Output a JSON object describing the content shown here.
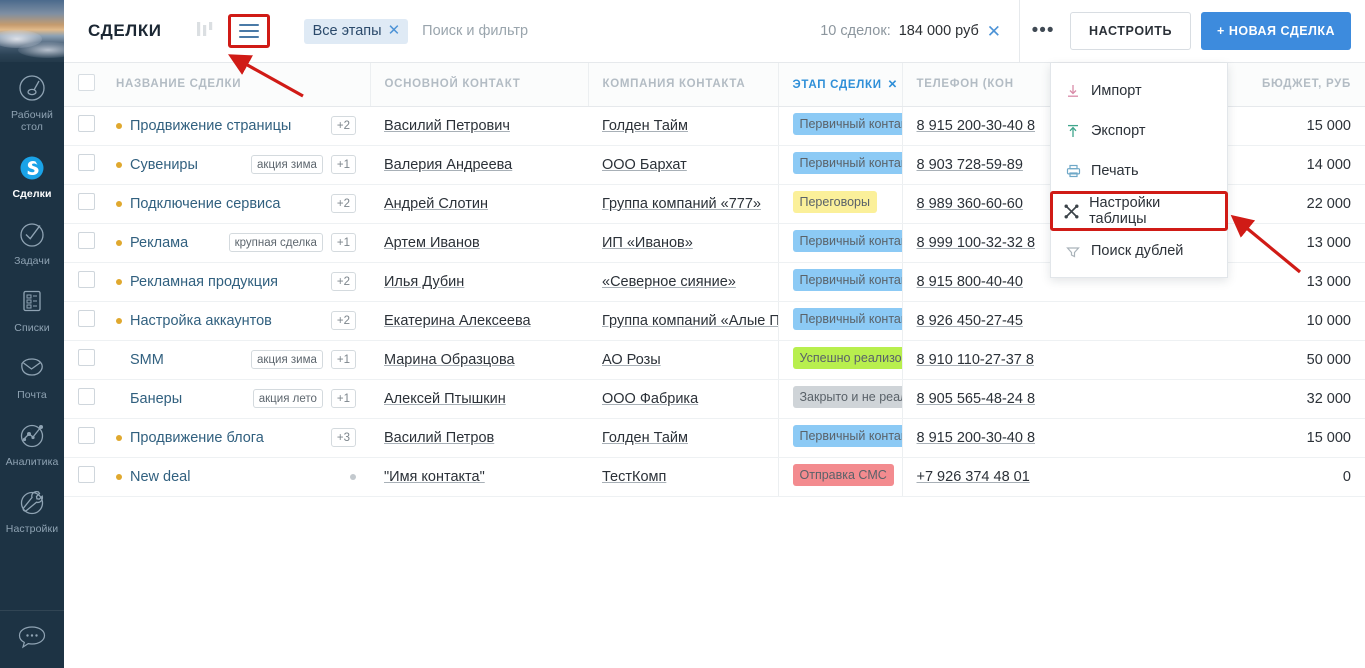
{
  "sidebar": {
    "items": [
      {
        "label": "Рабочий стол",
        "icon": "gauge-icon",
        "active": false
      },
      {
        "label": "Сделки",
        "icon": "deals-logo-icon",
        "active": true
      },
      {
        "label": "Задачи",
        "icon": "check-circle-icon",
        "active": false
      },
      {
        "label": "Списки",
        "icon": "list-icon",
        "active": false
      },
      {
        "label": "Почта",
        "icon": "mail-icon",
        "active": false
      },
      {
        "label": "Аналитика",
        "icon": "analytics-icon",
        "active": false
      },
      {
        "label": "Настройки",
        "icon": "wrench-icon",
        "active": false
      }
    ],
    "bottom": {
      "icon": "chat-bubble-icon"
    }
  },
  "topbar": {
    "title": "СДЕЛКИ",
    "kanban_icon": "kanban-view-icon",
    "list_icon": "list-view-icon",
    "filter_chip": {
      "label": "Все этапы",
      "close": "✕"
    },
    "search_placeholder": "Поиск и фильтр",
    "summary": {
      "label": "10 сделок:",
      "value": "184 000 руб",
      "close": "✕"
    },
    "more_label": "•••",
    "configure_label": "НАСТРОИТЬ",
    "new_deal_label": "+ НОВАЯ СДЕЛКА",
    "accent_color": "#3d8bdd"
  },
  "menu": {
    "items": [
      {
        "label": "Импорт",
        "icon": "import-down-arrow-icon",
        "highlight": false
      },
      {
        "label": "Экспорт",
        "icon": "export-up-arrow-icon",
        "highlight": false
      },
      {
        "label": "Печать",
        "icon": "printer-icon",
        "highlight": false
      },
      {
        "label": "Настройки таблицы",
        "icon": "table-settings-icon",
        "highlight": true
      },
      {
        "label": "Поиск дублей",
        "icon": "duplicate-search-icon",
        "highlight": false
      }
    ],
    "highlight_color": "#d01b16"
  },
  "table": {
    "columns": [
      {
        "label": "НАЗВАНИЕ СДЕЛКИ",
        "active": false
      },
      {
        "label": "ОСНОВНОЙ КОНТАКТ",
        "active": false
      },
      {
        "label": "КОМПАНИЯ КОНТАКТА",
        "active": false
      },
      {
        "label": "ЭТАП СДЕЛКИ",
        "active": true,
        "close": "✕"
      },
      {
        "label": "ТЕЛЕФОН (КОН",
        "active": false
      },
      {
        "label": "БЮДЖЕТ, РУБ",
        "active": false
      }
    ],
    "rows": [
      {
        "name": "Продвижение страницы",
        "dot": "orange",
        "tag": "",
        "count": "+2",
        "contact": "Василий Петрович",
        "company": "Голден Тайм",
        "stage": "Первичный контак",
        "stage_color": "blue",
        "phone": "8 915 200-30-40 8",
        "budget": "15 000"
      },
      {
        "name": "Сувениры",
        "dot": "orange",
        "tag": "акция зима",
        "count": "+1",
        "contact": "Валерия Андреева",
        "company": "ООО Бархат",
        "stage": "Первичный контак",
        "stage_color": "blue",
        "phone": "8 903 728-59-89",
        "budget": "14 000"
      },
      {
        "name": "Подключение сервиса",
        "dot": "orange",
        "tag": "",
        "count": "+2",
        "contact": "Андрей Слотин",
        "company": "Группа компаний «777»",
        "stage": "Переговоры",
        "stage_color": "yellow",
        "phone": "8 989 360-60-60",
        "budget": "22 000"
      },
      {
        "name": "Реклама",
        "dot": "orange",
        "tag": "крупная сделка",
        "count": "+1",
        "contact": "Артем Иванов",
        "company": "ИП «Иванов»",
        "stage": "Первичный контак",
        "stage_color": "blue",
        "phone": "8 999 100-32-32 8",
        "budget": "13 000"
      },
      {
        "name": "Рекламная продукция",
        "dot": "orange",
        "tag": "",
        "count": "+2",
        "contact": "Илья Дубин",
        "company": "«Северное сияние»",
        "stage": "Первичный контак",
        "stage_color": "blue",
        "phone": "8 915 800-40-40",
        "budget": "13 000"
      },
      {
        "name": "Настройка аккаунтов",
        "dot": "orange",
        "tag": "",
        "count": "+2",
        "contact": "Екатерина Алексеева",
        "company": "Группа компаний «Алые П",
        "stage": "Первичный контак",
        "stage_color": "blue",
        "phone": "8 926 450-27-45",
        "budget": "10 000"
      },
      {
        "name": "SMM",
        "dot": "none",
        "tag": "акция зима",
        "count": "+1",
        "contact": "Марина Образцова",
        "company": "АО Розы",
        "stage": "Успешно реализов",
        "stage_color": "green",
        "phone": "8 910 110-27-37 8",
        "budget": "50 000"
      },
      {
        "name": "Банеры",
        "dot": "none",
        "tag": "акция лето",
        "count": "+1",
        "contact": "Алексей Птышкин",
        "company": "ООО Фабрика",
        "stage": "Закрыто и не реал",
        "stage_color": "gray",
        "phone": "8 905 565-48-24 8",
        "budget": "32 000"
      },
      {
        "name": "Продвижение блога",
        "dot": "orange",
        "tag": "",
        "count": "+3",
        "contact": "Василий Петров",
        "company": "Голден Тайм",
        "stage": "Первичный контак",
        "stage_color": "blue",
        "phone": "8 915 200-30-40 8",
        "budget": "15 000"
      },
      {
        "name": "New deal",
        "dot": "orange",
        "tag": "",
        "count": "•",
        "contact": "\"Имя контакта\"",
        "company": "ТестКомп",
        "stage": "Отправка СМС",
        "stage_color": "red",
        "phone": "+7 926 374 48 01",
        "budget": "0"
      }
    ]
  }
}
